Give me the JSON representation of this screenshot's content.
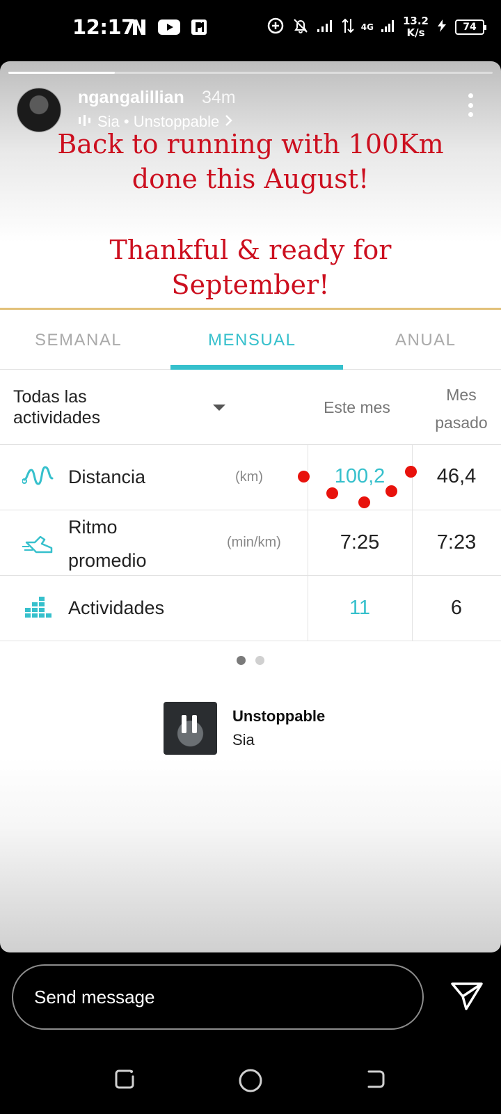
{
  "status_bar": {
    "time": "12:17",
    "network_type": "4G",
    "speed_value": "13.2",
    "speed_unit": "K/s",
    "battery": "74",
    "icons": [
      "netflix-icon",
      "youtube-icon",
      "parking-app-icon",
      "data-saver-icon",
      "notifications-off-icon",
      "signal-icon",
      "data-transfer-icon",
      "charging-icon"
    ]
  },
  "story": {
    "progress": 0.22,
    "username": "ngangalillian",
    "posted": "34m",
    "music_line": "Sia • Unstoppable",
    "caption_lines": [
      "Back to running with 100Km",
      "done this August!",
      "Thankful & ready for",
      "September!"
    ],
    "caption_color": "#cc0f1f"
  },
  "stats": {
    "tabs": [
      "SEMANAL",
      "MENSUAL",
      "ANUAL"
    ],
    "active_tab": "MENSUAL",
    "filter_label": "Todas las actividades",
    "column_current": "Este mes",
    "column_previous": "Mes pasado",
    "accent_color": "#36c0cc",
    "rows": [
      {
        "label": "Distancia",
        "unit": "(km)",
        "current": "100,2",
        "previous": "46,4"
      },
      {
        "label": "Ritmo promedio",
        "unit": "(min/km)",
        "current": "7:25",
        "previous": "7:23"
      },
      {
        "label": "Actividades",
        "unit": "",
        "current": "11",
        "previous": "6"
      }
    ],
    "pager_pages": 2,
    "pager_active": 1
  },
  "music_sticker": {
    "title": "Unstoppable",
    "artist": "Sia"
  },
  "composer": {
    "placeholder": "Send message"
  }
}
